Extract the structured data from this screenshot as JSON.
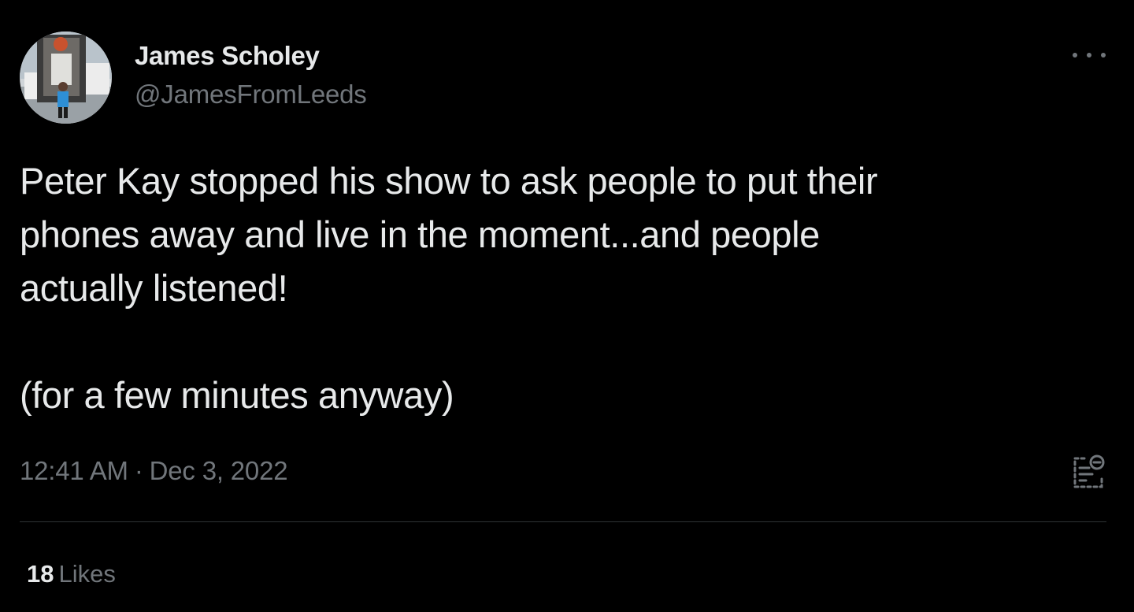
{
  "author": {
    "display_name": "James Scholey",
    "handle": "@JamesFromLeeds"
  },
  "tweet": {
    "lines": [
      "Peter Kay stopped his show to ask people to put their",
      "phones away and live in the moment...and people",
      "actually listened!"
    ],
    "extra_paragraph": "(for a few minutes anyway)",
    "time": "12:41 AM",
    "separator": "·",
    "date": "Dec 3, 2022"
  },
  "stats": {
    "likes_count": "18",
    "likes_label": "Likes"
  },
  "icons": {
    "more": "more-horizontal-icon",
    "analytics": "analytics-icon"
  },
  "colors": {
    "background": "#000000",
    "primary_text": "#e7e9ea",
    "secondary_text": "#71767b",
    "divider": "#2f3336"
  }
}
